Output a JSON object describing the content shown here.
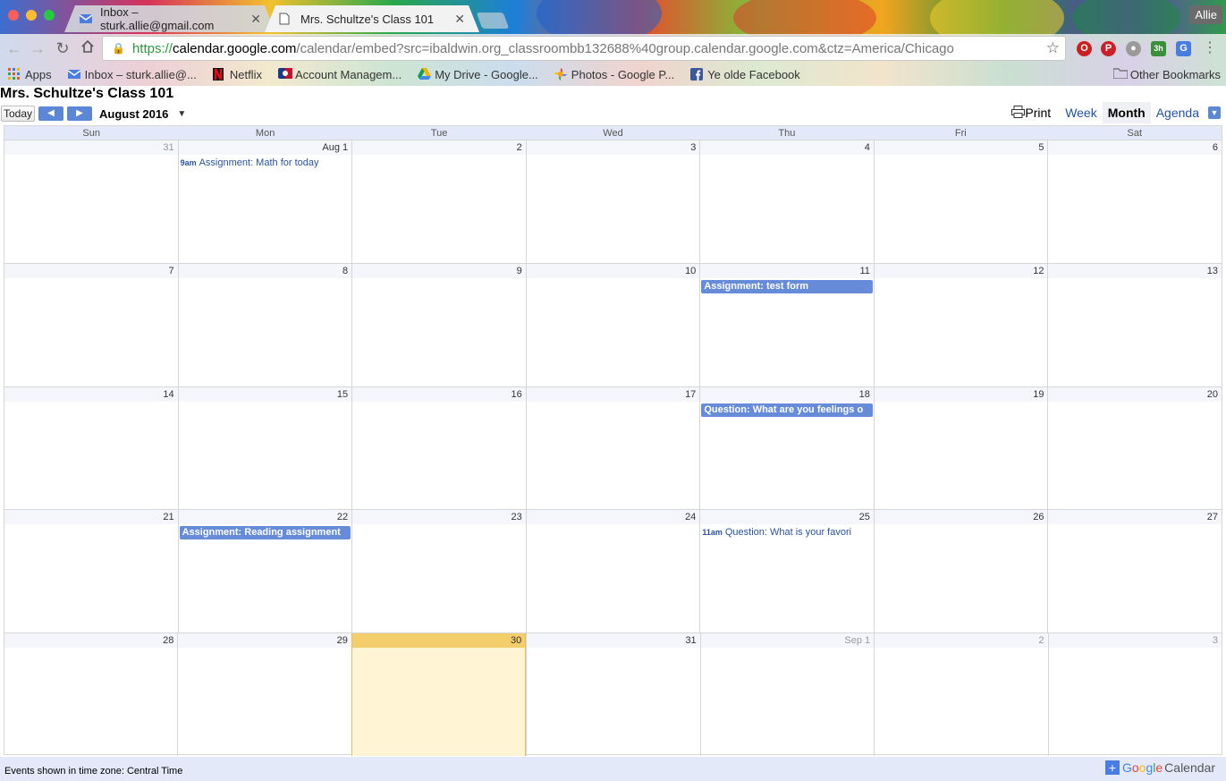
{
  "browser": {
    "tabs": [
      {
        "label": "Inbox – sturk.allie@gmail.com",
        "active": false
      },
      {
        "label": "Mrs. Schultze's Class 101",
        "active": true
      }
    ],
    "user": "Allie",
    "url": {
      "scheme": "https://",
      "host": "calendar.google.com",
      "path": "/calendar/embed?src=ibaldwin.org_classroombb132688%40group.calendar.google.com&ctz=America/Chicago"
    },
    "extension_badge": "3h",
    "bookmarks": [
      {
        "label": "Apps",
        "icon": "apps-grid-icon"
      },
      {
        "label": "Inbox – sturk.allie@...",
        "icon": "inbox-icon"
      },
      {
        "label": "Netflix",
        "icon": "netflix-icon"
      },
      {
        "label": "Account Managem...",
        "icon": "mlb-icon"
      },
      {
        "label": "My Drive - Google...",
        "icon": "drive-icon"
      },
      {
        "label": "Photos - Google P...",
        "icon": "photos-icon"
      },
      {
        "label": "Ye olde Facebook",
        "icon": "facebook-icon"
      }
    ],
    "other_bookmarks": "Other Bookmarks"
  },
  "calendar": {
    "title": "Mrs. Schultze's Class 101",
    "today_label": "Today",
    "month_label": "August 2016",
    "print_label": "Print",
    "views": [
      {
        "label": "Week",
        "selected": false
      },
      {
        "label": "Month",
        "selected": true
      },
      {
        "label": "Agenda",
        "selected": false
      }
    ],
    "weekdays": [
      "Sun",
      "Mon",
      "Tue",
      "Wed",
      "Thu",
      "Fri",
      "Sat"
    ],
    "weeks": [
      [
        {
          "label": "31",
          "other": true
        },
        {
          "label": "Aug 1",
          "event": {
            "kind": "timed",
            "time": "9am",
            "title": "Assignment: Math for today"
          }
        },
        {
          "label": "2"
        },
        {
          "label": "3"
        },
        {
          "label": "4"
        },
        {
          "label": "5"
        },
        {
          "label": "6"
        }
      ],
      [
        {
          "label": "7"
        },
        {
          "label": "8"
        },
        {
          "label": "9"
        },
        {
          "label": "10"
        },
        {
          "label": "11",
          "event": {
            "kind": "allday",
            "title": "Assignment: test form"
          }
        },
        {
          "label": "12"
        },
        {
          "label": "13"
        }
      ],
      [
        {
          "label": "14"
        },
        {
          "label": "15"
        },
        {
          "label": "16"
        },
        {
          "label": "17"
        },
        {
          "label": "18",
          "event": {
            "kind": "allday",
            "title": "Question: What are you feelings o"
          }
        },
        {
          "label": "19"
        },
        {
          "label": "20"
        }
      ],
      [
        {
          "label": "21"
        },
        {
          "label": "22",
          "event": {
            "kind": "allday",
            "title": "Assignment: Reading assignment"
          }
        },
        {
          "label": "23"
        },
        {
          "label": "24"
        },
        {
          "label": "25",
          "event": {
            "kind": "timed",
            "time": "11am",
            "title": "Question: What is your favori"
          }
        },
        {
          "label": "26"
        },
        {
          "label": "27"
        }
      ],
      [
        {
          "label": "28"
        },
        {
          "label": "29"
        },
        {
          "label": "30",
          "today": true
        },
        {
          "label": "31"
        },
        {
          "label": "Sep 1",
          "other": true
        },
        {
          "label": "2",
          "other": true
        },
        {
          "label": "3",
          "other": true
        }
      ]
    ],
    "footer_timezone": "Events shown in time zone: Central Time",
    "brand": {
      "google": "Google",
      "calendar": "Calendar"
    },
    "colors": {
      "event": "#668cd9",
      "today_header": "#f4ce6a",
      "today_bg": "#fff5d5",
      "header_bg": "#e3e9f8"
    }
  }
}
